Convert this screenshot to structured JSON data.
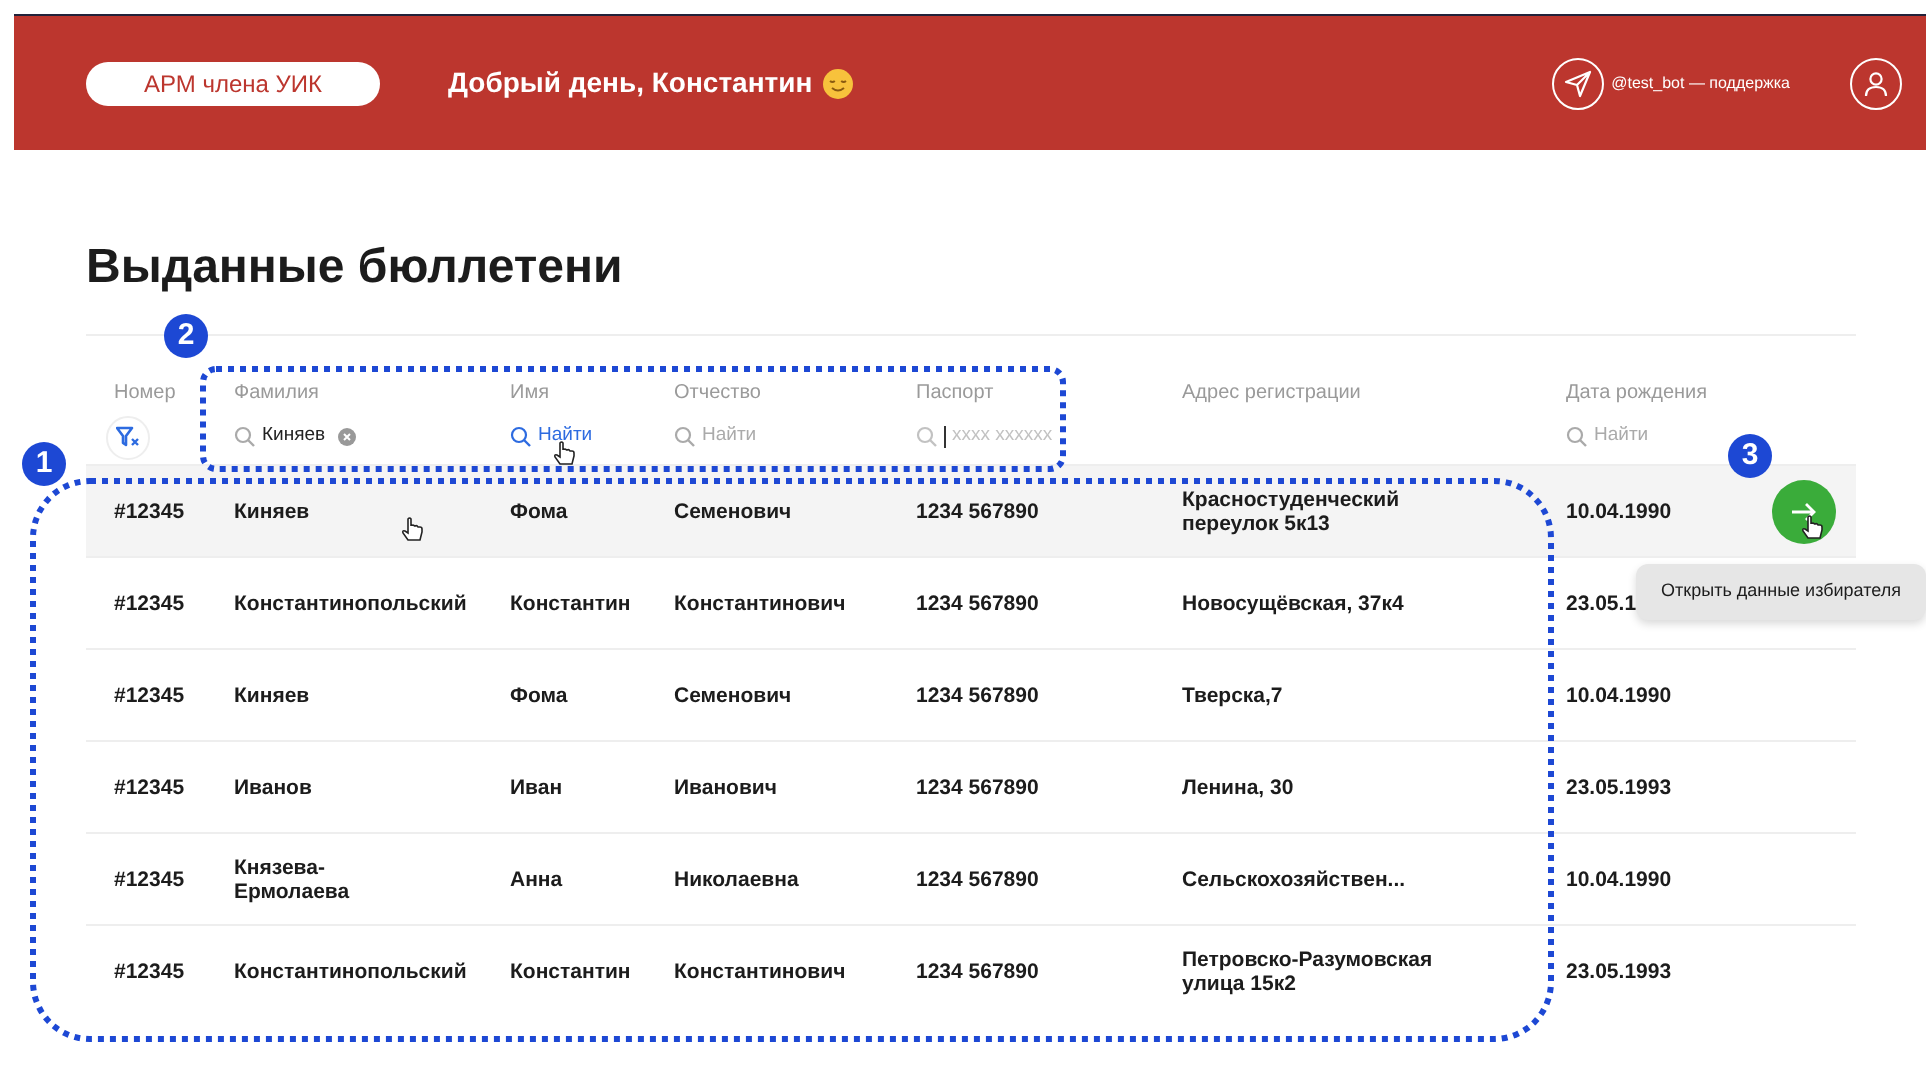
{
  "header": {
    "app_button": "АРМ члена УИК",
    "greeting": "Добрый день, Константин",
    "support_link": "@test_bot — поддержка"
  },
  "title": "Выданные бюллетени",
  "table": {
    "columns": [
      {
        "label": "Номер",
        "filter": {
          "kind": "clear"
        }
      },
      {
        "label": "Фамилия",
        "filter": {
          "kind": "search",
          "value": "Киняев",
          "highlighted": false,
          "focused": false
        }
      },
      {
        "label": "Имя",
        "filter": {
          "kind": "search",
          "placeholder": "Найти",
          "highlighted": true,
          "focused": false
        }
      },
      {
        "label": "Отчество",
        "filter": {
          "kind": "search",
          "placeholder": "Найти",
          "highlighted": false,
          "focused": false
        }
      },
      {
        "label": "Паспорт",
        "filter": {
          "kind": "search",
          "placeholder": "xxxx xxxxxx",
          "highlighted": false,
          "focused": true
        }
      },
      {
        "label": "Адрес регистрации",
        "filter": {
          "kind": "none"
        }
      },
      {
        "label": "Дата рождения",
        "filter": {
          "kind": "search",
          "placeholder": "Найти",
          "highlighted": false,
          "focused": false
        }
      }
    ],
    "rows": [
      {
        "hovered": true,
        "open_button": true,
        "cells": [
          "#12345",
          "Киняев",
          "Фома",
          "Семенович",
          "1234 567890",
          "Красностуденческий переулок 5к13",
          "10.04.1990"
        ]
      },
      {
        "hovered": false,
        "open_button": false,
        "cells": [
          "#12345",
          "Константинопольский",
          "Константин",
          "Константинович",
          "1234 567890",
          "Новосущёвская, 37к4",
          "23.05.1"
        ]
      },
      {
        "hovered": false,
        "open_button": false,
        "cells": [
          "#12345",
          "Киняев",
          "Фома",
          "Семенович",
          "1234 567890",
          "Тверска,7",
          "10.04.1990"
        ]
      },
      {
        "hovered": false,
        "open_button": false,
        "cells": [
          "#12345",
          "Иванов",
          "Иван",
          "Иванович",
          "1234 567890",
          "Ленина, 30",
          "23.05.1993"
        ]
      },
      {
        "hovered": false,
        "open_button": false,
        "cells": [
          "#12345",
          "Князева-Ермолаева",
          "Анна",
          "Николаевна",
          "1234 567890",
          "Сельскохозяйствен...",
          "10.04.1990"
        ]
      },
      {
        "hovered": false,
        "open_button": false,
        "cells": [
          "#12345",
          "Константинопольский",
          "Константин",
          "Константинович",
          "1234 567890",
          "Петровско-Разумовская улица 15к2",
          "23.05.1993"
        ]
      }
    ]
  },
  "tooltip": "Открыть данные избирателя",
  "annotations": [
    {
      "label": "1"
    },
    {
      "label": "2"
    },
    {
      "label": "3"
    }
  ]
}
